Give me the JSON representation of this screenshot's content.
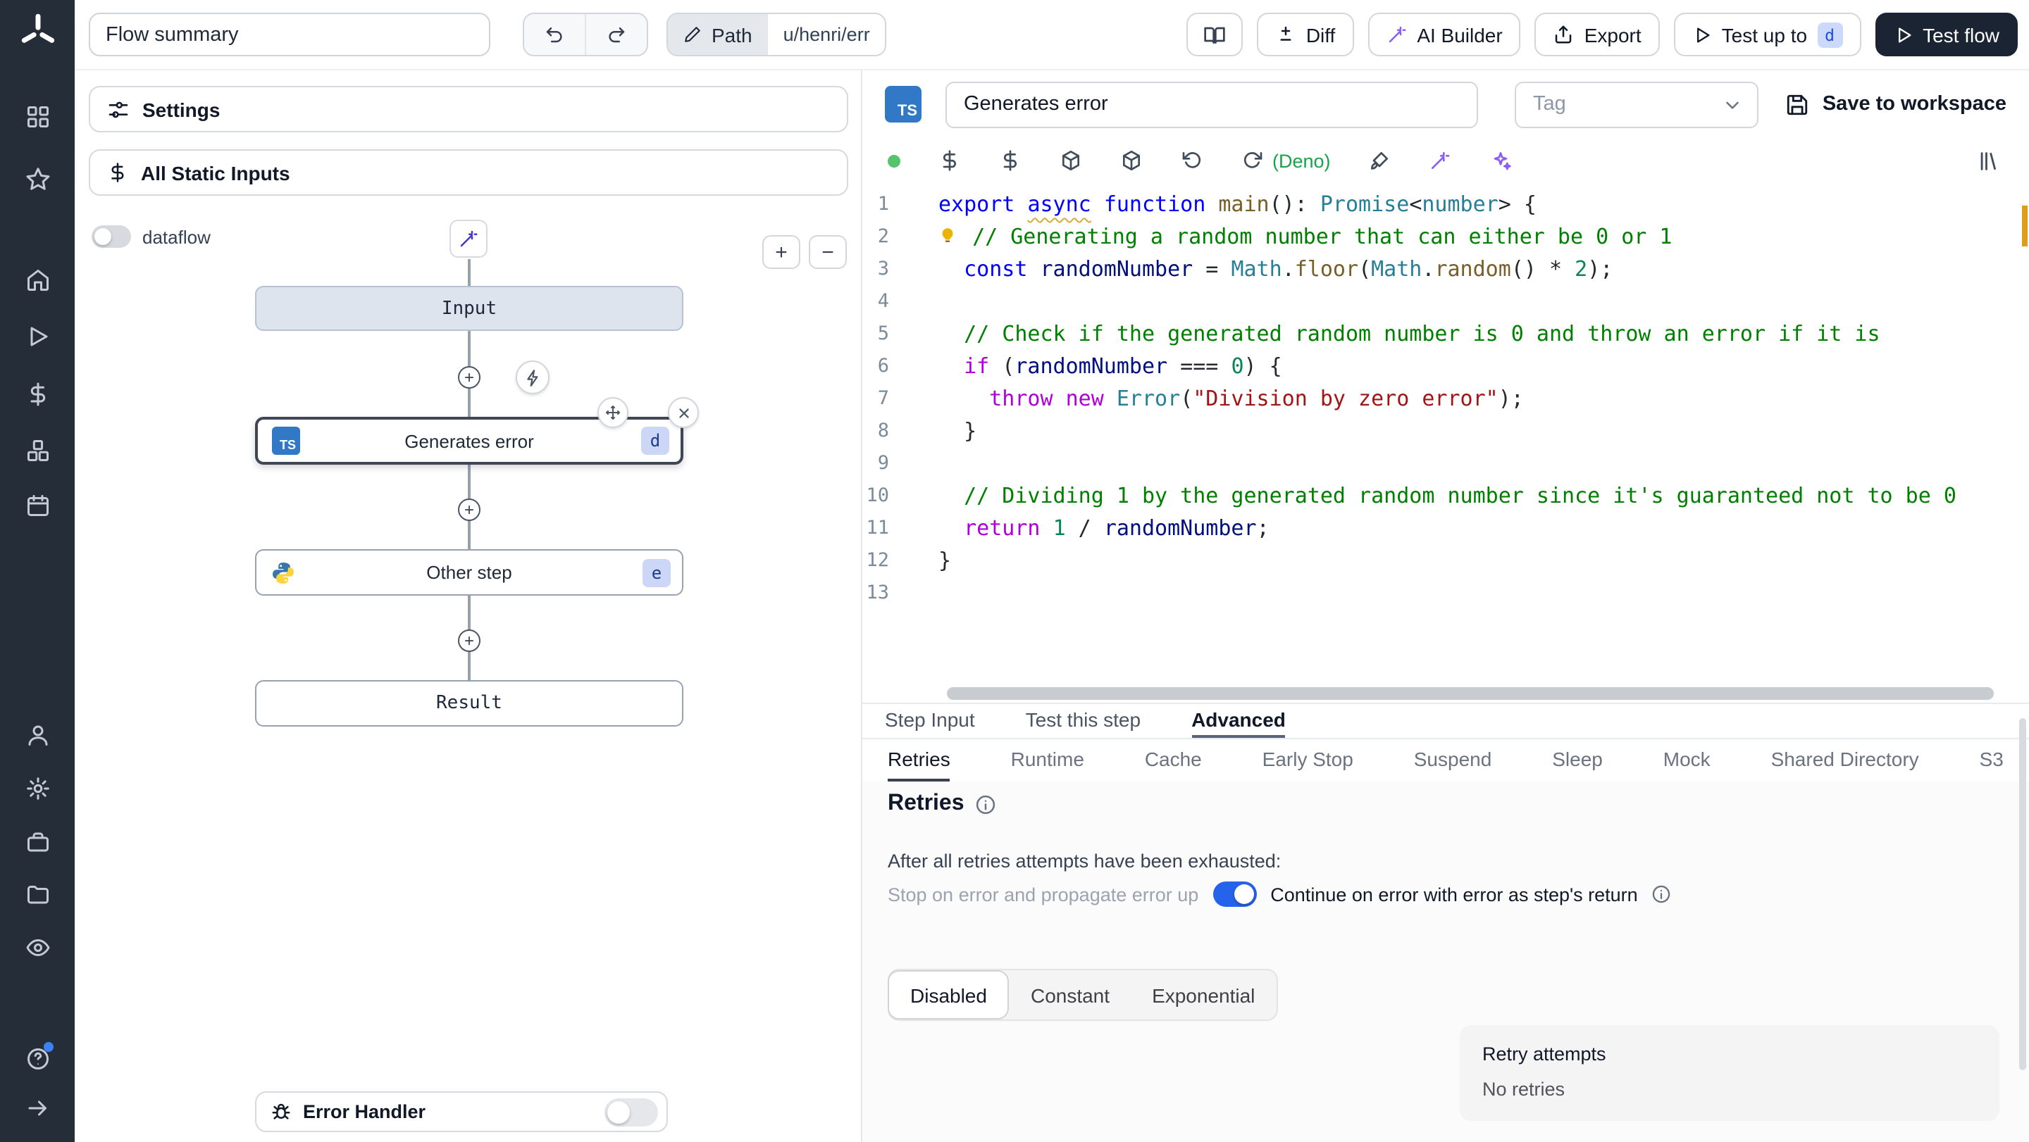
{
  "colors": {
    "accent_blue": "#2563eb",
    "ts_blue": "#3178c6",
    "deno_green": "#16a34a",
    "ai_purple": "#8b5cf6",
    "warning_marker": "#dd9f1b",
    "sidebar_bg": "#252d38",
    "test_flow_bg": "#1b2433",
    "badge_bg": "#ccd7f7"
  },
  "sidebar": {
    "icon_names": [
      "windmill-logo",
      "apps-grid",
      "star",
      "home",
      "runs-play",
      "variables-dollar",
      "resources-boxes",
      "schedules-calendar",
      "user",
      "settings-gear",
      "workers-toolbox",
      "folders",
      "audit-eye",
      "help",
      "expand-arrow"
    ]
  },
  "topbar": {
    "flow_summary": "Flow summary",
    "path_label": "Path",
    "path_value": "u/henri/err",
    "diff": "Diff",
    "ai_builder": "AI Builder",
    "export": "Export",
    "test_up_to": "Test up to",
    "test_up_to_badge": "d",
    "test_flow": "Test flow"
  },
  "flow_panel": {
    "settings": "Settings",
    "all_static_inputs": "All Static Inputs",
    "dataflow": "dataflow",
    "zoom_in": "+",
    "zoom_out": "−",
    "input_node": "Input",
    "step_node_lang": "TS",
    "step_node_label": "Generates error",
    "step_node_badge": "d",
    "other_node_label": "Other step",
    "other_node_badge": "e",
    "result_node": "Result",
    "error_handler": "Error Handler"
  },
  "step_header": {
    "lang_badge": "TS",
    "name": "Generates error",
    "tag_placeholder": "Tag",
    "save": "Save to workspace",
    "runtime": "(Deno)"
  },
  "code_editor": {
    "lines": [
      {
        "num": "1",
        "tokens": [
          [
            "kw",
            "export "
          ],
          [
            "kw sq",
            "async"
          ],
          [
            "p",
            " "
          ],
          [
            "kw",
            "function "
          ],
          [
            "fn",
            "main"
          ],
          [
            "p",
            "(): "
          ],
          [
            "ty",
            "Promise"
          ],
          [
            "p",
            "<"
          ],
          [
            "ty",
            "number"
          ],
          [
            "p",
            "> {"
          ]
        ]
      },
      {
        "num": "2",
        "tokens": [
          [
            "bulb",
            ""
          ],
          [
            "p",
            " "
          ],
          [
            "cm",
            "// Generating a random number that can either be 0 or 1"
          ]
        ]
      },
      {
        "num": "3",
        "tokens": [
          [
            "p",
            "  "
          ],
          [
            "kw",
            "const "
          ],
          [
            "vr",
            "randomNumber"
          ],
          [
            "p",
            " = "
          ],
          [
            "ty",
            "Math"
          ],
          [
            "p",
            "."
          ],
          [
            "fn",
            "floor"
          ],
          [
            "p",
            "("
          ],
          [
            "ty",
            "Math"
          ],
          [
            "p",
            "."
          ],
          [
            "fn",
            "random"
          ],
          [
            "p",
            "() * "
          ],
          [
            "nm",
            "2"
          ],
          [
            "p",
            ");"
          ]
        ]
      },
      {
        "num": "4",
        "tokens": []
      },
      {
        "num": "5",
        "tokens": [
          [
            "p",
            "  "
          ],
          [
            "cm",
            "// Check if the generated random number is 0 and throw an error if it is"
          ]
        ]
      },
      {
        "num": "6",
        "tokens": [
          [
            "p",
            "  "
          ],
          [
            "ct",
            "if"
          ],
          [
            "p",
            " ("
          ],
          [
            "vr",
            "randomNumber"
          ],
          [
            "p",
            " === "
          ],
          [
            "nm",
            "0"
          ],
          [
            "p",
            ") {"
          ]
        ]
      },
      {
        "num": "7",
        "tokens": [
          [
            "p",
            "    "
          ],
          [
            "ct",
            "throw "
          ],
          [
            "ct",
            "new "
          ],
          [
            "ty",
            "Error"
          ],
          [
            "p",
            "("
          ],
          [
            "st",
            "\"Division by zero error\""
          ],
          [
            "p",
            ");"
          ]
        ]
      },
      {
        "num": "8",
        "tokens": [
          [
            "p",
            "  }"
          ]
        ]
      },
      {
        "num": "9",
        "tokens": []
      },
      {
        "num": "10",
        "tokens": [
          [
            "p",
            "  "
          ],
          [
            "cm",
            "// Dividing 1 by the generated random number since it's guaranteed not to be 0"
          ]
        ]
      },
      {
        "num": "11",
        "tokens": [
          [
            "p",
            "  "
          ],
          [
            "ct",
            "return "
          ],
          [
            "nm",
            "1"
          ],
          [
            "p",
            " / "
          ],
          [
            "vr",
            "randomNumber"
          ],
          [
            "p",
            ";"
          ]
        ]
      },
      {
        "num": "12",
        "tokens": [
          [
            "p",
            "}"
          ]
        ]
      },
      {
        "num": "13",
        "tokens": []
      }
    ]
  },
  "bottom_panel": {
    "tabs": [
      {
        "label": "Step Input"
      },
      {
        "label": "Test this step"
      },
      {
        "label": "Advanced",
        "active": true
      }
    ],
    "subtabs": [
      {
        "label": "Retries",
        "active": true
      },
      {
        "label": "Runtime"
      },
      {
        "label": "Cache"
      },
      {
        "label": "Early Stop"
      },
      {
        "label": "Suspend"
      },
      {
        "label": "Sleep"
      },
      {
        "label": "Mock"
      },
      {
        "label": "Shared Directory"
      },
      {
        "label": "S3"
      }
    ],
    "retries": {
      "title": "Retries",
      "description": "After all retries attempts have been exhausted:",
      "stop_option": "Stop on error and propagate error up",
      "continue_option": "Continue on error with error as step's return",
      "modes": [
        {
          "label": "Disabled",
          "active": true
        },
        {
          "label": "Constant"
        },
        {
          "label": "Exponential"
        }
      ],
      "attempts_title": "Retry attempts",
      "attempts_value": "No retries"
    }
  }
}
